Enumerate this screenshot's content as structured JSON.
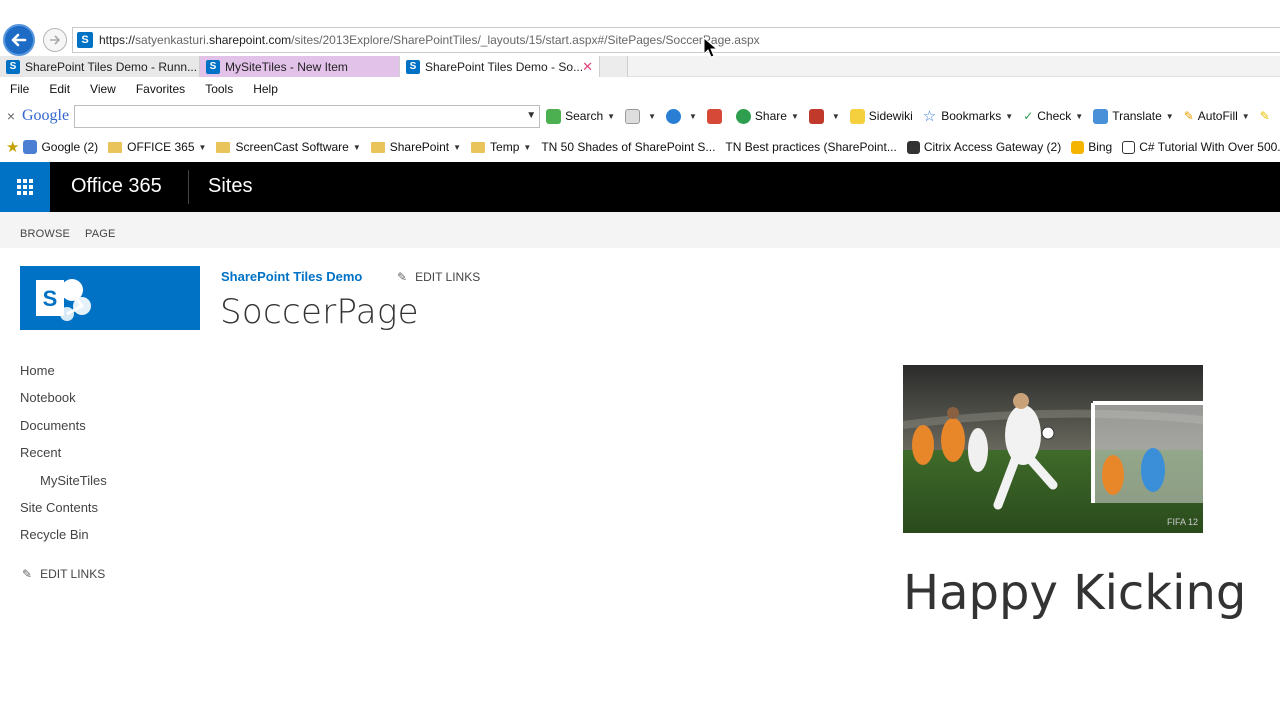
{
  "browser": {
    "url": {
      "prefix": "https://",
      "pre_domain": "satyenkasturi.",
      "domain": "sharepoint.com",
      "path": "/sites/2013Explore/SharePointTiles/_layouts/15/start.aspx#/SitePages/SoccerPage.aspx"
    },
    "tabs": [
      {
        "label": "SharePoint Tiles Demo - Runn..."
      },
      {
        "label": "MySiteTiles - New Item"
      },
      {
        "label": "SharePoint Tiles Demo - So..."
      }
    ],
    "menu": [
      "File",
      "Edit",
      "View",
      "Favorites",
      "Tools",
      "Help"
    ],
    "google_toolbar": {
      "logo": "Google",
      "search_value": "",
      "items": {
        "search": "Search",
        "share": "Share",
        "sidewiki": "Sidewiki",
        "bookmarks": "Bookmarks",
        "check": "Check",
        "translate": "Translate",
        "autofill": "AutoFill"
      }
    },
    "favorites": [
      {
        "label": "Google (2)",
        "kind": "google"
      },
      {
        "label": "OFFICE 365",
        "kind": "folder",
        "menu": true
      },
      {
        "label": "ScreenCast Software",
        "kind": "folder",
        "menu": true
      },
      {
        "label": "SharePoint",
        "kind": "folder",
        "menu": true
      },
      {
        "label": "Temp",
        "kind": "folder",
        "menu": true
      },
      {
        "label": "TN 50 Shades of SharePoint S...",
        "kind": "link"
      },
      {
        "label": "TN Best practices (SharePoint...",
        "kind": "link"
      },
      {
        "label": "Citrix Access Gateway (2)",
        "kind": "citrix"
      },
      {
        "label": "Bing",
        "kind": "bing"
      },
      {
        "label": "C# Tutorial With Over 500...",
        "kind": "grid"
      }
    ]
  },
  "suite": {
    "brand": "Office 365",
    "app": "Sites"
  },
  "ribbon": {
    "tabs": [
      "BROWSE",
      "PAGE"
    ]
  },
  "page": {
    "site_title": "SharePoint Tiles Demo",
    "edit_links": "EDIT LINKS",
    "title": "SoccerPage",
    "caption": "Happy Kicking",
    "image_watermark": "FIFA 12"
  },
  "quick_launch": {
    "items": [
      "Home",
      "Notebook",
      "Documents",
      "Recent",
      "MySiteTiles",
      "Site Contents",
      "Recycle Bin"
    ],
    "edit_links": "EDIT LINKS"
  },
  "colors": {
    "accent": "#0072c6",
    "suite_bar": "#000000",
    "ribbon_bg": "#f4f4f4"
  }
}
